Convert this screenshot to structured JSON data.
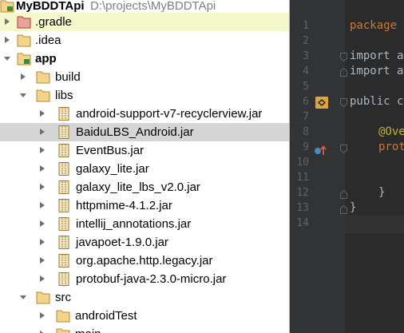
{
  "project": {
    "root_name": "MyBDDTApi",
    "root_path": "D:\\projects\\MyBDDTApi"
  },
  "tree": {
    "gradle": ".gradle",
    "idea": ".idea",
    "app": "app",
    "build": "build",
    "libs": "libs",
    "jars": [
      "android-support-v7-recyclerview.jar",
      "BaiduLBS_Android.jar",
      "EventBus.jar",
      "galaxy_lite.jar",
      "galaxy_lite_lbs_v2.0.jar",
      "httpmime-4.1.2.jar",
      "intellij_annotations.jar",
      "javapoet-1.9.0.jar",
      "org.apache.http.legacy.jar",
      "protobuf-java-2.3.0-micro.jar"
    ],
    "src": "src",
    "androidTest": "androidTest",
    "main": "main"
  },
  "editor": {
    "line_numbers": [
      "1",
      "2",
      "3",
      "4",
      "5",
      "6",
      "7",
      "8",
      "9",
      "10",
      "11",
      "12",
      "13",
      "14"
    ],
    "code": {
      "l1": "package",
      "l3": "import a",
      "l4": "import a",
      "l6": "public c",
      "l8": "@Ove",
      "l9": "proto",
      "l12": "}",
      "l13": "}"
    }
  },
  "colors": {
    "selected_row": "#d5d5d5",
    "highlight_row": "#f5f8cb",
    "editor_bg": "#2b2b2b",
    "gutter_bg": "#313335",
    "keyword": "#cc7832",
    "annotation": "#bbb529"
  }
}
